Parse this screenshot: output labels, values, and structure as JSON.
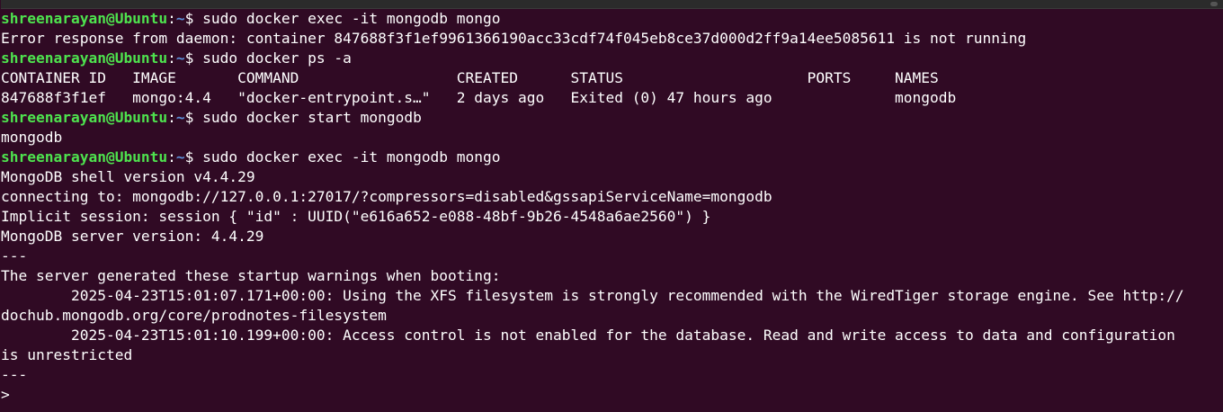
{
  "window": {
    "title": "shreenarayan@Ubuntu: ~"
  },
  "prompt": {
    "user_host": "shreenarayan@Ubuntu",
    "sep": ":",
    "path": "~",
    "symbol": "$ "
  },
  "colors": {
    "background": "#300a24",
    "prompt_user": "#4ee34e",
    "prompt_path": "#5b8ed6",
    "text": "#ffffff"
  },
  "lines": [
    {
      "type": "cmd",
      "text": "sudo docker exec -it mongodb mongo"
    },
    {
      "type": "out",
      "text": "Error response from daemon: container 847688f3f1ef9961366190acc33cdf74f045eb8ce37d000d2ff9a14ee5085611 is not running"
    },
    {
      "type": "cmd",
      "text": "sudo docker ps -a"
    },
    {
      "type": "out",
      "text": "CONTAINER ID   IMAGE       COMMAND                  CREATED      STATUS                     PORTS     NAMES"
    },
    {
      "type": "out",
      "text": "847688f3f1ef   mongo:4.4   \"docker-entrypoint.s…\"   2 days ago   Exited (0) 47 hours ago              mongodb"
    },
    {
      "type": "cmd",
      "text": "sudo docker start mongodb"
    },
    {
      "type": "out",
      "text": "mongodb"
    },
    {
      "type": "cmd",
      "text": "sudo docker exec -it mongodb mongo"
    },
    {
      "type": "out",
      "text": "MongoDB shell version v4.4.29"
    },
    {
      "type": "out",
      "text": "connecting to: mongodb://127.0.0.1:27017/?compressors=disabled&gssapiServiceName=mongodb"
    },
    {
      "type": "out",
      "text": "Implicit session: session { \"id\" : UUID(\"e616a652-e088-48bf-9b26-4548a6ae2560\") }"
    },
    {
      "type": "out",
      "text": "MongoDB server version: 4.4.29"
    },
    {
      "type": "out",
      "text": "---"
    },
    {
      "type": "out",
      "text": "The server generated these startup warnings when booting:"
    },
    {
      "type": "out",
      "text": "        2025-04-23T15:01:07.171+00:00: Using the XFS filesystem is strongly recommended with the WiredTiger storage engine. See http://"
    },
    {
      "type": "out",
      "text": "dochub.mongodb.org/core/prodnotes-filesystem"
    },
    {
      "type": "out",
      "text": "        2025-04-23T15:01:10.199+00:00: Access control is not enabled for the database. Read and write access to data and configuration"
    },
    {
      "type": "out",
      "text": "is unrestricted"
    },
    {
      "type": "out",
      "text": "---"
    },
    {
      "type": "out",
      "text": "> "
    }
  ]
}
